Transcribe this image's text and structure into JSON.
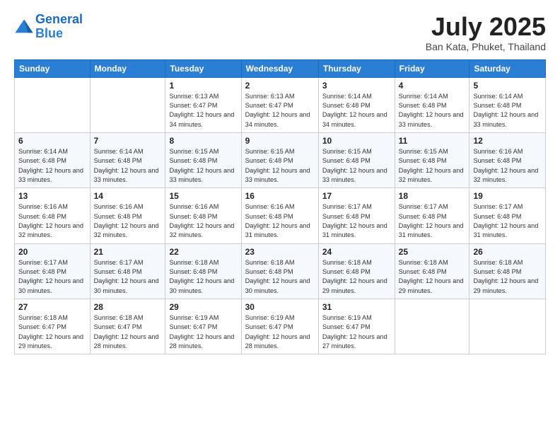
{
  "header": {
    "logo_text_general": "General",
    "logo_text_blue": "Blue",
    "month_title": "July 2025",
    "subtitle": "Ban Kata, Phuket, Thailand"
  },
  "weekdays": [
    "Sunday",
    "Monday",
    "Tuesday",
    "Wednesday",
    "Thursday",
    "Friday",
    "Saturday"
  ],
  "weeks": [
    [
      {
        "day": "",
        "sunrise": "",
        "sunset": "",
        "daylight": ""
      },
      {
        "day": "",
        "sunrise": "",
        "sunset": "",
        "daylight": ""
      },
      {
        "day": "1",
        "sunrise": "Sunrise: 6:13 AM",
        "sunset": "Sunset: 6:47 PM",
        "daylight": "Daylight: 12 hours and 34 minutes."
      },
      {
        "day": "2",
        "sunrise": "Sunrise: 6:13 AM",
        "sunset": "Sunset: 6:47 PM",
        "daylight": "Daylight: 12 hours and 34 minutes."
      },
      {
        "day": "3",
        "sunrise": "Sunrise: 6:14 AM",
        "sunset": "Sunset: 6:48 PM",
        "daylight": "Daylight: 12 hours and 34 minutes."
      },
      {
        "day": "4",
        "sunrise": "Sunrise: 6:14 AM",
        "sunset": "Sunset: 6:48 PM",
        "daylight": "Daylight: 12 hours and 33 minutes."
      },
      {
        "day": "5",
        "sunrise": "Sunrise: 6:14 AM",
        "sunset": "Sunset: 6:48 PM",
        "daylight": "Daylight: 12 hours and 33 minutes."
      }
    ],
    [
      {
        "day": "6",
        "sunrise": "Sunrise: 6:14 AM",
        "sunset": "Sunset: 6:48 PM",
        "daylight": "Daylight: 12 hours and 33 minutes."
      },
      {
        "day": "7",
        "sunrise": "Sunrise: 6:14 AM",
        "sunset": "Sunset: 6:48 PM",
        "daylight": "Daylight: 12 hours and 33 minutes."
      },
      {
        "day": "8",
        "sunrise": "Sunrise: 6:15 AM",
        "sunset": "Sunset: 6:48 PM",
        "daylight": "Daylight: 12 hours and 33 minutes."
      },
      {
        "day": "9",
        "sunrise": "Sunrise: 6:15 AM",
        "sunset": "Sunset: 6:48 PM",
        "daylight": "Daylight: 12 hours and 33 minutes."
      },
      {
        "day": "10",
        "sunrise": "Sunrise: 6:15 AM",
        "sunset": "Sunset: 6:48 PM",
        "daylight": "Daylight: 12 hours and 33 minutes."
      },
      {
        "day": "11",
        "sunrise": "Sunrise: 6:15 AM",
        "sunset": "Sunset: 6:48 PM",
        "daylight": "Daylight: 12 hours and 32 minutes."
      },
      {
        "day": "12",
        "sunrise": "Sunrise: 6:16 AM",
        "sunset": "Sunset: 6:48 PM",
        "daylight": "Daylight: 12 hours and 32 minutes."
      }
    ],
    [
      {
        "day": "13",
        "sunrise": "Sunrise: 6:16 AM",
        "sunset": "Sunset: 6:48 PM",
        "daylight": "Daylight: 12 hours and 32 minutes."
      },
      {
        "day": "14",
        "sunrise": "Sunrise: 6:16 AM",
        "sunset": "Sunset: 6:48 PM",
        "daylight": "Daylight: 12 hours and 32 minutes."
      },
      {
        "day": "15",
        "sunrise": "Sunrise: 6:16 AM",
        "sunset": "Sunset: 6:48 PM",
        "daylight": "Daylight: 12 hours and 32 minutes."
      },
      {
        "day": "16",
        "sunrise": "Sunrise: 6:16 AM",
        "sunset": "Sunset: 6:48 PM",
        "daylight": "Daylight: 12 hours and 31 minutes."
      },
      {
        "day": "17",
        "sunrise": "Sunrise: 6:17 AM",
        "sunset": "Sunset: 6:48 PM",
        "daylight": "Daylight: 12 hours and 31 minutes."
      },
      {
        "day": "18",
        "sunrise": "Sunrise: 6:17 AM",
        "sunset": "Sunset: 6:48 PM",
        "daylight": "Daylight: 12 hours and 31 minutes."
      },
      {
        "day": "19",
        "sunrise": "Sunrise: 6:17 AM",
        "sunset": "Sunset: 6:48 PM",
        "daylight": "Daylight: 12 hours and 31 minutes."
      }
    ],
    [
      {
        "day": "20",
        "sunrise": "Sunrise: 6:17 AM",
        "sunset": "Sunset: 6:48 PM",
        "daylight": "Daylight: 12 hours and 30 minutes."
      },
      {
        "day": "21",
        "sunrise": "Sunrise: 6:17 AM",
        "sunset": "Sunset: 6:48 PM",
        "daylight": "Daylight: 12 hours and 30 minutes."
      },
      {
        "day": "22",
        "sunrise": "Sunrise: 6:18 AM",
        "sunset": "Sunset: 6:48 PM",
        "daylight": "Daylight: 12 hours and 30 minutes."
      },
      {
        "day": "23",
        "sunrise": "Sunrise: 6:18 AM",
        "sunset": "Sunset: 6:48 PM",
        "daylight": "Daylight: 12 hours and 30 minutes."
      },
      {
        "day": "24",
        "sunrise": "Sunrise: 6:18 AM",
        "sunset": "Sunset: 6:48 PM",
        "daylight": "Daylight: 12 hours and 29 minutes."
      },
      {
        "day": "25",
        "sunrise": "Sunrise: 6:18 AM",
        "sunset": "Sunset: 6:48 PM",
        "daylight": "Daylight: 12 hours and 29 minutes."
      },
      {
        "day": "26",
        "sunrise": "Sunrise: 6:18 AM",
        "sunset": "Sunset: 6:48 PM",
        "daylight": "Daylight: 12 hours and 29 minutes."
      }
    ],
    [
      {
        "day": "27",
        "sunrise": "Sunrise: 6:18 AM",
        "sunset": "Sunset: 6:47 PM",
        "daylight": "Daylight: 12 hours and 29 minutes."
      },
      {
        "day": "28",
        "sunrise": "Sunrise: 6:18 AM",
        "sunset": "Sunset: 6:47 PM",
        "daylight": "Daylight: 12 hours and 28 minutes."
      },
      {
        "day": "29",
        "sunrise": "Sunrise: 6:19 AM",
        "sunset": "Sunset: 6:47 PM",
        "daylight": "Daylight: 12 hours and 28 minutes."
      },
      {
        "day": "30",
        "sunrise": "Sunrise: 6:19 AM",
        "sunset": "Sunset: 6:47 PM",
        "daylight": "Daylight: 12 hours and 28 minutes."
      },
      {
        "day": "31",
        "sunrise": "Sunrise: 6:19 AM",
        "sunset": "Sunset: 6:47 PM",
        "daylight": "Daylight: 12 hours and 27 minutes."
      },
      {
        "day": "",
        "sunrise": "",
        "sunset": "",
        "daylight": ""
      },
      {
        "day": "",
        "sunrise": "",
        "sunset": "",
        "daylight": ""
      }
    ]
  ]
}
